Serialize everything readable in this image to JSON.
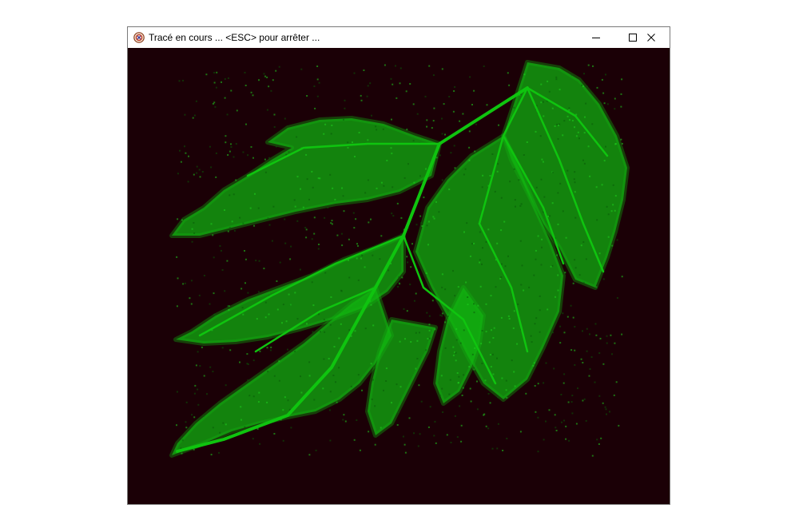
{
  "window": {
    "title": "Tracé en cours ... <ESC> pour arrêter ...",
    "icon": "app-icon",
    "controls": {
      "minimize": "minimize-icon",
      "maximize": "maximize-icon",
      "close": "close-icon"
    }
  },
  "canvas": {
    "background_color": "#1b0006",
    "fractal_color": "#11b511",
    "content": "fractal-fern-leaf"
  }
}
